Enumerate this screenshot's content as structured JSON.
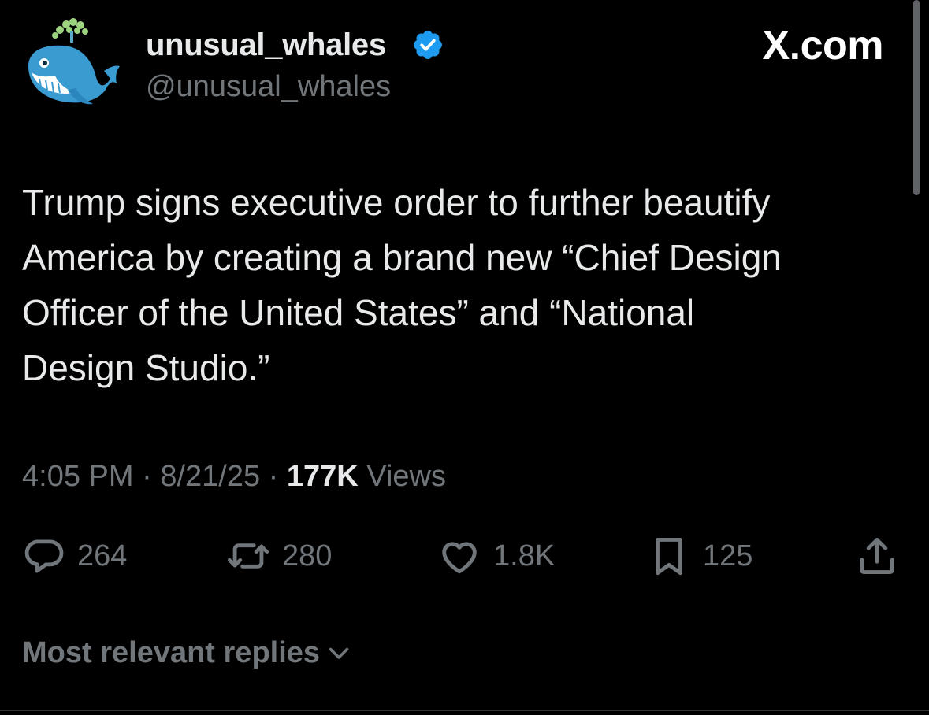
{
  "author": {
    "display_name": "unusual_whales",
    "handle": "@unusual_whales",
    "verified": true,
    "verified_color": "#1d9bf0",
    "avatar_icon": "whale-logo-icon"
  },
  "site_label": "X.com",
  "tweet": {
    "text": "Trump signs executive order to further beautify\nAmerica by creating a brand new “Chief Design\nOfficer of the United States” and “National\nDesign Studio.”"
  },
  "meta": {
    "time": "4:05 PM",
    "separator": " · ",
    "date": "8/21/25",
    "views_count": "177K",
    "views_label": " Views"
  },
  "actions": {
    "replies": {
      "icon": "reply-icon",
      "count": "264"
    },
    "reposts": {
      "icon": "repost-icon",
      "count": "280"
    },
    "likes": {
      "icon": "heart-icon",
      "count": "1.8K"
    },
    "bookmarks": {
      "icon": "bookmark-icon",
      "count": "125"
    },
    "share": {
      "icon": "share-icon"
    }
  },
  "replies_sort": {
    "label": "Most relevant replies",
    "icon": "chevron-down-icon"
  },
  "colors": {
    "background": "#000000",
    "primary_text": "#e7e9ea",
    "secondary_text": "#71767b",
    "accent": "#1d9bf0"
  }
}
